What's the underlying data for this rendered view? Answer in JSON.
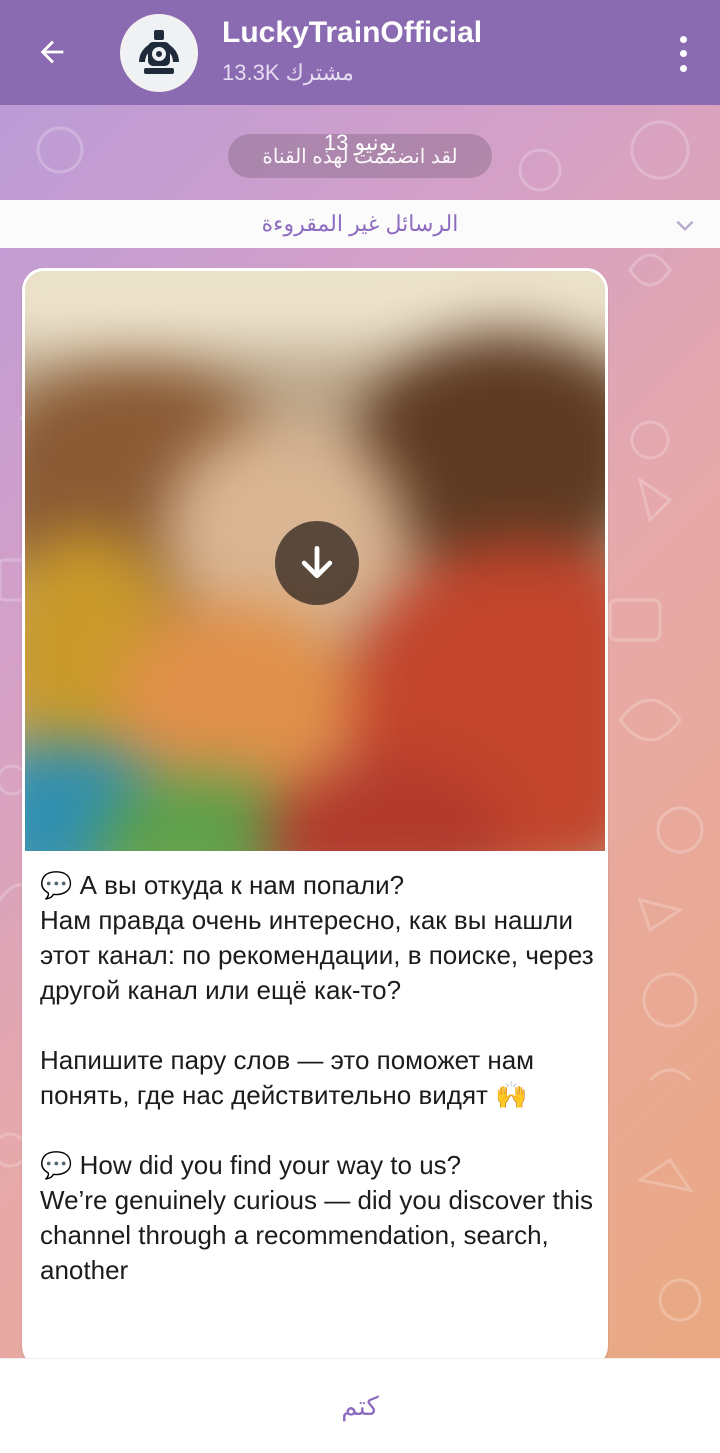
{
  "header": {
    "title": "LuckyTrainOfficial",
    "subtitle": "13.3K مشترك"
  },
  "chat": {
    "date_label": "13 يونيو",
    "joined_label": "لقد انضممت لهذه القناة",
    "unread_label": "الرسائل غير المقروءة"
  },
  "message": {
    "text_ru_1": "💬 А вы откуда к нам попали?\nНам правда очень интересно, как вы нашли этот канал: по рекомендации, в поиске, через другой канал или ещё как-то?",
    "text_ru_2": "Напишите пару слов — это поможет нам понять, где нас действительно видят 🙌",
    "text_en_1": "💬 How did you find your way to us?\nWe’re genuinely curious — did you discover this channel through a recommendation, search, another"
  },
  "footer": {
    "mute_label": "كتم"
  },
  "icons": {
    "back": "arrow-left-icon",
    "menu": "more-vertical-icon",
    "download": "download-arrow-icon",
    "chevron": "chevron-down-icon"
  },
  "colors": {
    "header": "#8a6ab0",
    "accent": "#8e6cc0"
  }
}
